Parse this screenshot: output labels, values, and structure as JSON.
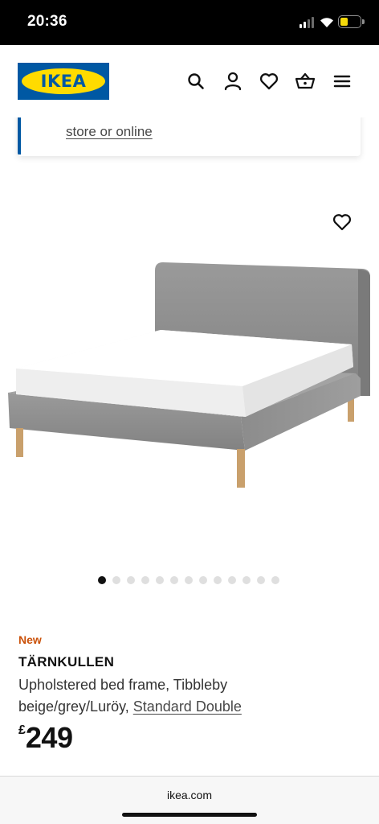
{
  "status_bar": {
    "time": "20:36",
    "battery_color": "#f5d90a"
  },
  "header": {
    "logo_text": "IKEA",
    "brand_blue": "#0058a3",
    "brand_yellow": "#ffdb00",
    "icons": [
      "search-icon",
      "account-icon",
      "favourites-icon",
      "basket-icon",
      "menu-icon"
    ]
  },
  "notice": {
    "link_text": "store or online"
  },
  "product": {
    "image_count": 13,
    "active_image_index": 0,
    "badge": "New",
    "badge_color": "#ca5008",
    "name": "TÄRNKULLEN",
    "description_line1": "Upholstered bed frame, Tibbleby",
    "description_line2_prefix": "beige/grey/Luröy, ",
    "variant_link": "Standard Double",
    "currency": "£",
    "price": "249"
  },
  "browser": {
    "url": "ikea.com"
  }
}
